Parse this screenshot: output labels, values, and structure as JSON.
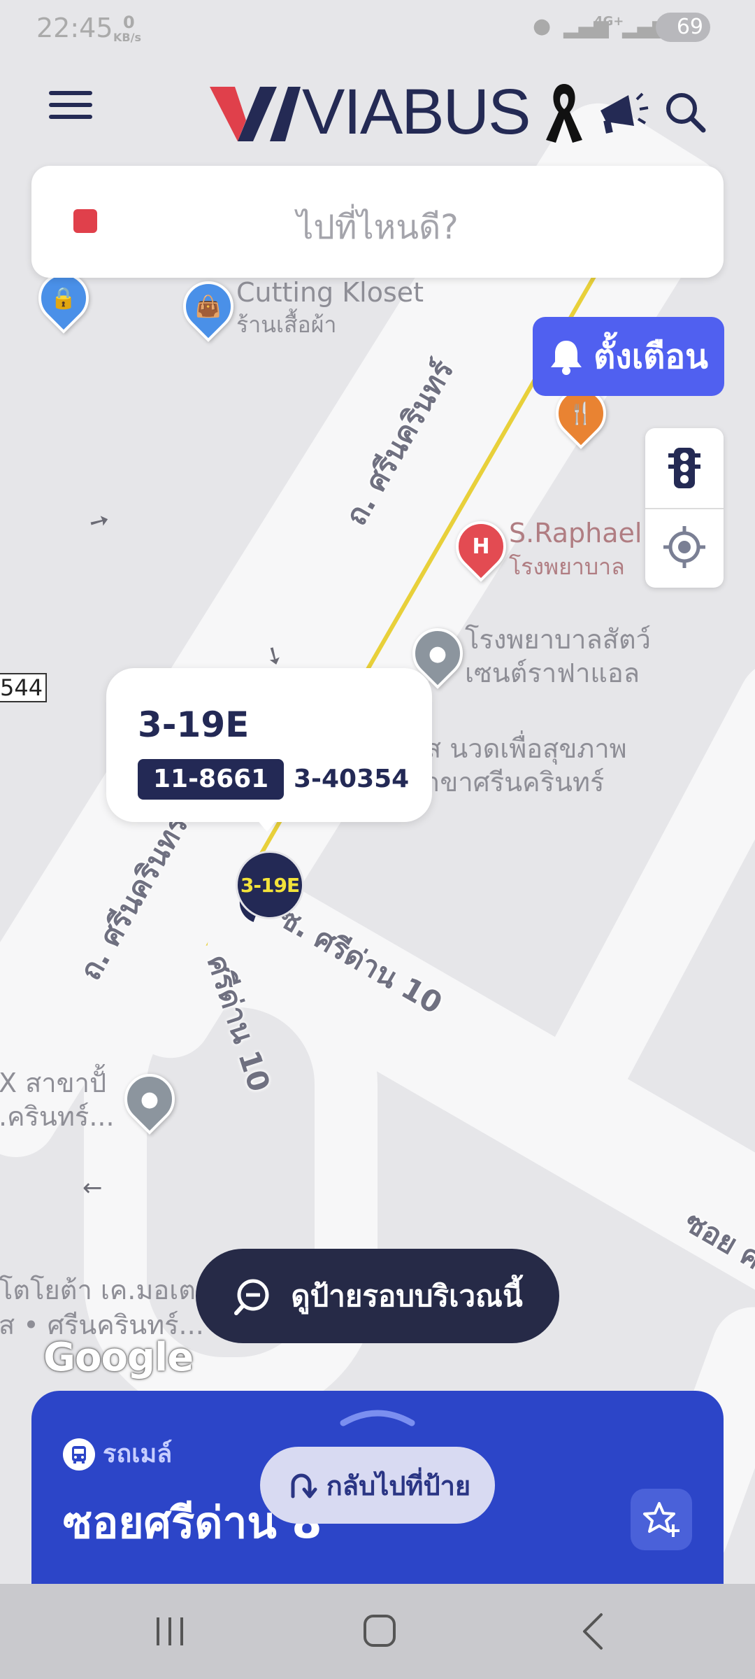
{
  "status_bar": {
    "time": "22:45",
    "net_speed_value": "0",
    "net_speed_unit": "KB/s",
    "network": "4G+",
    "battery": "69"
  },
  "header": {
    "logo_text": "VIABUS"
  },
  "search": {
    "placeholder": "ไปที่ไหนดี?"
  },
  "alert_button": {
    "label": "ตั้งเตือน"
  },
  "map": {
    "places": [
      {
        "name": "Cutting Kloset",
        "subtitle": "ร้านเสื้อผ้า"
      },
      {
        "name": "S.Raphael",
        "subtitle": "โรงพยาบาล"
      },
      {
        "name": "โรงพยาบาลสัตว์",
        "subtitle": "เซนต์ราฟาแอล"
      },
      {
        "name": "ส นวดเพื่อสุขภาพ",
        "subtitle": "าขาศรีนครินทร์"
      },
      {
        "name": "X สาขาปั้",
        "subtitle": ".ครินทร์..."
      },
      {
        "name": "โตโยต้า เค.มอเตอ",
        "subtitle": "ส • ศรีนครินทร์..."
      }
    ],
    "roads": {
      "srinakarin_top": "ถ. ศรีนครินทร์",
      "srinakarin_bottom": "ถ. ศรีนครินทร์",
      "soi_sridan_10": "ซ. ศรีด่าน 10",
      "sridan_10_vertical": "ศรีด่าน 10",
      "soi_right": "ซอย ศ",
      "edge_number": "544"
    },
    "google_attribution": "Google"
  },
  "bus_popup": {
    "route": "3-19E",
    "plate_primary": "11-8661",
    "plate_secondary": "3-40354"
  },
  "bus_marker": {
    "label": "3-19E"
  },
  "nearby_button": {
    "label": "ดูป้ายรอบบริเวณนี้"
  },
  "bottom_sheet": {
    "stop_type": "รถเมล์",
    "stop_name": "ซอยศรีด่าน 8"
  },
  "back_to_stop_button": {
    "label": "กลับไปที่ป้าย"
  },
  "colors": {
    "brand_navy": "#232955",
    "brand_red": "#e0404b",
    "alert_blue": "#5060f0",
    "sheet_blue": "#2c45c8",
    "bus_label_yellow": "#f3e33a"
  },
  "icons": [
    "menu-icon",
    "ribbon-icon",
    "megaphone-icon",
    "search-icon",
    "bell-icon",
    "traffic-light-icon",
    "locate-icon",
    "zoom-out-icon",
    "bus-icon",
    "star-plus-icon",
    "return-icon"
  ]
}
